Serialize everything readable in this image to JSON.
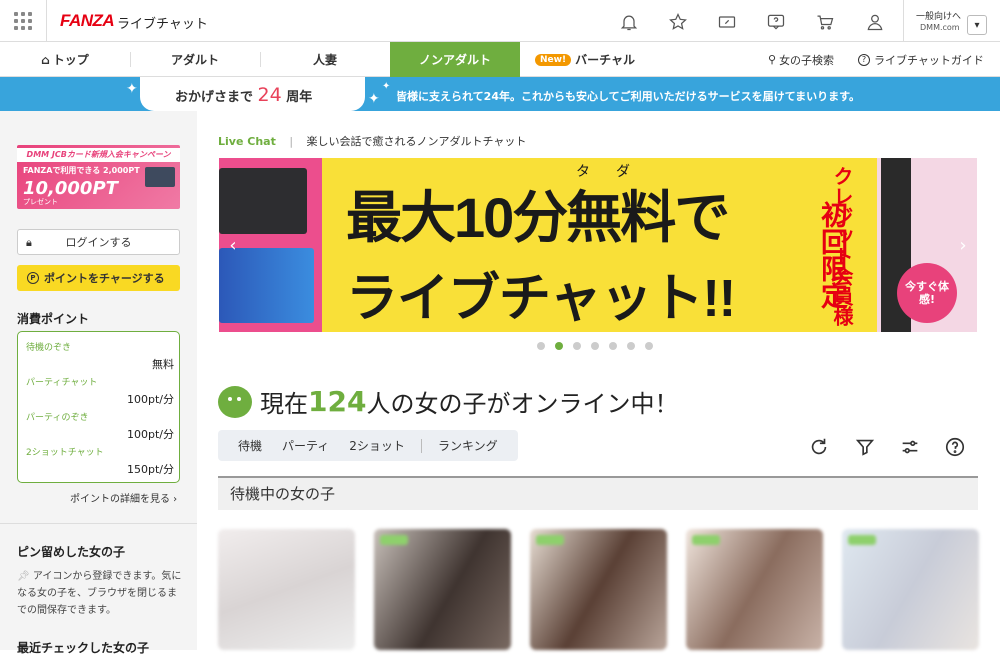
{
  "header": {
    "logo": "FANZA",
    "app_name": "ライブチャット",
    "icons": [
      "bell-icon",
      "star-icon",
      "coupon-icon",
      "help-icon",
      "cart-icon",
      "user-icon"
    ],
    "account_line1": "一般向けへ",
    "account_line2": "DMM.com",
    "dropdown": "▾"
  },
  "nav": {
    "items": [
      {
        "label": "トップ"
      },
      {
        "label": "アダルト"
      },
      {
        "label": "人妻"
      },
      {
        "label": "ノンアダルト",
        "active": true
      },
      {
        "label": "バーチャル",
        "badge": "New!"
      }
    ],
    "search": "女の子検索",
    "guide": "ライブチャットガイド"
  },
  "anniversary": {
    "prefix": "おかげさまで",
    "number": "24",
    "suffix": "周年",
    "message": "皆様に支えられて24年。これからも安心してご利用いただけるサービスを届けてまいります。"
  },
  "sidebar": {
    "promo": {
      "title": "DMM JCBカード新規入会キャンペーン",
      "line2": "FANZAで利用できる 2,000PT",
      "amount": "10,000PT",
      "suffix": "プレゼント"
    },
    "login": "ログインする",
    "charge": "ポイントをチャージする",
    "points_title": "消費ポイント",
    "points": [
      {
        "label": "待機のぞき",
        "value": "無料"
      },
      {
        "label": "パーティチャット",
        "value": "100pt/分"
      },
      {
        "label": "パーティのぞき",
        "value": "100pt/分"
      },
      {
        "label": "2ショットチャット",
        "value": "150pt/分"
      }
    ],
    "points_detail": "ポイントの詳細を見る ›",
    "pinned_title": "ピン留めした女の子",
    "pinned_desc": "アイコンから登録できます。気になる女の子を、ブラウザを閉じるまでの間保存できます。",
    "recent_title": "最近チェックした女の子"
  },
  "main": {
    "breadcrumb_label": "Live Chat",
    "breadcrumb_sep": "|",
    "breadcrumb_desc": "楽しい会話で癒されるノンアダルトチャット",
    "banner": {
      "furigana": "タダ",
      "line1": "最大10分無料で",
      "line2": "ライブチャット!!",
      "red1": "初回限定",
      "red2": "クレジット会員様",
      "bubble": "今すぐ体感!"
    },
    "carousel_count": 7,
    "carousel_active": 1,
    "online_prefix": "現在",
    "online_count": "124",
    "online_suffix": "人の女の子がオンライン中！",
    "tabs": [
      "待機",
      "パーティ",
      "2ショット",
      "ランキング"
    ],
    "section_title": "待機中の女の子",
    "thumb_colors": [
      "#d9d4d4",
      "#7a6a62",
      "#b9a59a",
      "#c9b3a8",
      "#c8ccd8"
    ]
  },
  "colors": {
    "brand_red": "#e60012",
    "accent_green": "#6fae3f",
    "anniv_blue": "#38a4dc",
    "banner_yellow": "#f9e038"
  }
}
